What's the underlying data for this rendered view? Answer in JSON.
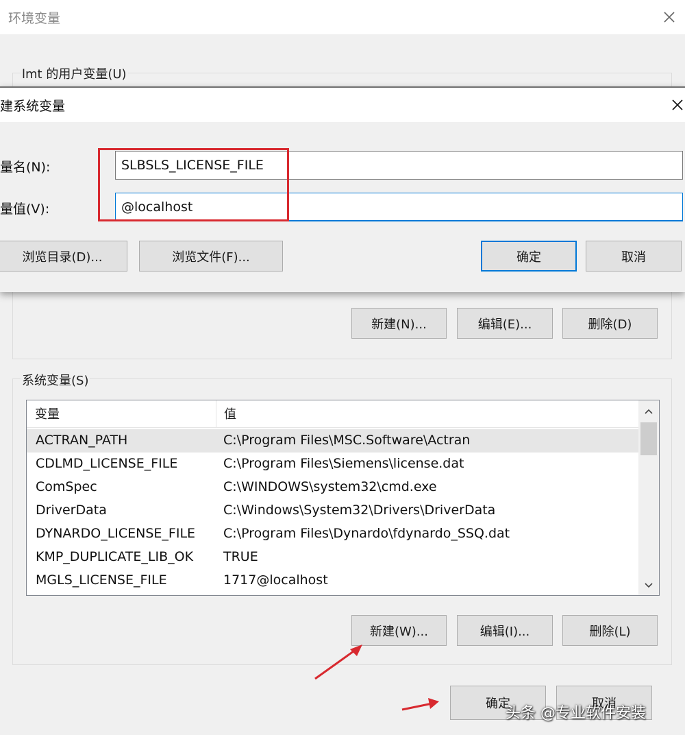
{
  "env_window": {
    "title": "环境变量",
    "user_vars_label": "lmt 的用户变量(U)",
    "user_buttons": {
      "new": "新建(N)...",
      "edit": "编辑(E)...",
      "delete": "删除(D)"
    },
    "system_vars_label": "系统变量(S)",
    "system_table": {
      "headers": {
        "name": "变量",
        "value": "值"
      },
      "rows": [
        {
          "name": "ACTRAN_PATH",
          "value": "C:\\Program Files\\MSC.Software\\Actran"
        },
        {
          "name": "CDLMD_LICENSE_FILE",
          "value": "C:\\Program Files\\Siemens\\license.dat"
        },
        {
          "name": "ComSpec",
          "value": "C:\\WINDOWS\\system32\\cmd.exe"
        },
        {
          "name": "DriverData",
          "value": "C:\\Windows\\System32\\Drivers\\DriverData"
        },
        {
          "name": "DYNARDO_LICENSE_FILE",
          "value": "C:\\Program Files\\Dynardo\\fdynardo_SSQ.dat"
        },
        {
          "name": "KMP_DUPLICATE_LIB_OK",
          "value": "TRUE"
        },
        {
          "name": "MGLS_LICENSE_FILE",
          "value": "1717@localhost"
        }
      ]
    },
    "system_buttons": {
      "new": "新建(W)...",
      "edit": "编辑(I)...",
      "delete": "删除(L)"
    },
    "footer_buttons": {
      "ok": "确定",
      "cancel": "取消"
    }
  },
  "new_var_dialog": {
    "title": "建系统变量",
    "name_label": "量名(N):",
    "name_value": "SLBSLS_LICENSE_FILE",
    "value_label": "量值(V):",
    "value_value": "@localhost",
    "browse_dir": "浏览目录(D)...",
    "browse_file": "浏览文件(F)...",
    "ok": "确定",
    "cancel": "取消"
  },
  "watermark": "头条 @专业软件安装",
  "colors": {
    "highlight_box": "#d8292f",
    "arrow": "#d8292f",
    "focus_accent": "#0078d7"
  },
  "icons": [
    "close-icon",
    "scroll-up-icon",
    "scroll-down-icon",
    "red-arrow-icon"
  ]
}
